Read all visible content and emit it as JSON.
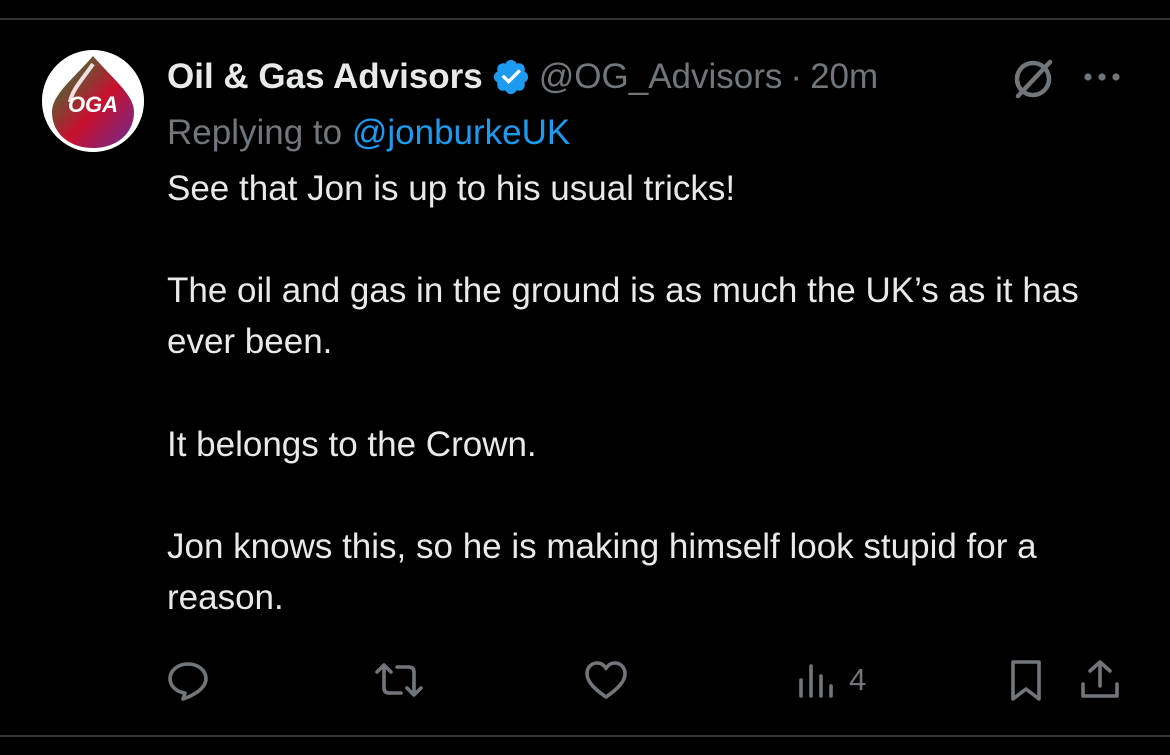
{
  "colors": {
    "background": "#000000",
    "text": "#e7e9ea",
    "muted": "#71767b",
    "accent": "#1d9bf0",
    "divider": "#2f3336"
  },
  "author": {
    "avatar_text": "OGA",
    "display_name": "Oil & Gas Advisors",
    "verified_icon": "verified-badge-icon",
    "handle": "@OG_Advisors",
    "separator": "·",
    "time": "20m"
  },
  "reply_context": {
    "prefix": "Replying to",
    "mention": "@jonburkeUK"
  },
  "tweet": {
    "paragraphs": [
      "See that Jon is up to his usual tricks!",
      "The oil and gas in the ground is as much the UK’s as it has ever been.",
      "It belongs to the Crown.",
      "Jon knows this, so he is making himself look stupid for a reason."
    ]
  },
  "actions": {
    "reply": {
      "icon": "reply-icon"
    },
    "retweet": {
      "icon": "retweet-icon"
    },
    "like": {
      "icon": "heart-icon"
    },
    "views": {
      "icon": "views-chart-icon",
      "count": "4"
    },
    "bookmark": {
      "icon": "bookmark-icon"
    },
    "share": {
      "icon": "share-icon"
    }
  },
  "header_icons": {
    "grok": "grok-icon",
    "more": "more-dots-icon"
  }
}
